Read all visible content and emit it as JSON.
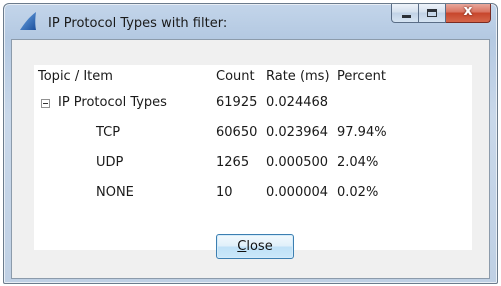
{
  "window": {
    "title": "IP Protocol Types with filter:",
    "close_glyph": "x"
  },
  "table": {
    "headers": {
      "topic": "Topic / Item",
      "count": "Count",
      "rate": "Rate (ms)",
      "percent": "Percent"
    },
    "rows": [
      {
        "topic": "IP Protocol Types",
        "count": "61925",
        "rate": "0.024468",
        "percent": ""
      },
      {
        "topic": "TCP",
        "count": "60650",
        "rate": "0.023964",
        "percent": "97.94%"
      },
      {
        "topic": "UDP",
        "count": "1265",
        "rate": "0.000500",
        "percent": "2.04%"
      },
      {
        "topic": "NONE",
        "count": "10",
        "rate": "0.000004",
        "percent": "0.02%"
      }
    ]
  },
  "buttons": {
    "close_label": "Close"
  },
  "colors": {
    "accent": "#3c7fb1",
    "close_button": "#c7462c"
  },
  "icons": {
    "app": "wireshark-fin-icon",
    "expander": "minus-box-icon",
    "minimize": "minimize-icon",
    "maximize": "maximize-icon",
    "close": "close-icon"
  }
}
